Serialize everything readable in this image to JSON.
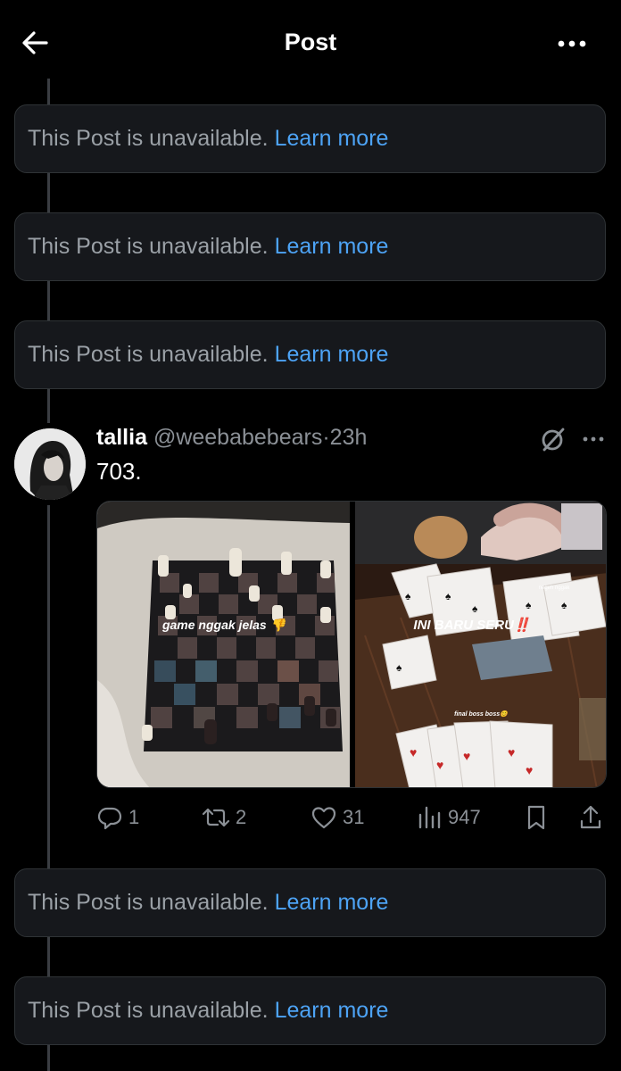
{
  "header": {
    "title": "Post"
  },
  "unavailable_notices": [
    {
      "text": "This Post is unavailable.",
      "link": "Learn more"
    },
    {
      "text": "This Post is unavailable.",
      "link": "Learn more"
    },
    {
      "text": "This Post is unavailable.",
      "link": "Learn more"
    },
    {
      "text": "This Post is unavailable.",
      "link": "Learn more"
    },
    {
      "text": "This Post is unavailable.",
      "link": "Learn more"
    }
  ],
  "post": {
    "display_name": "tallia",
    "handle": "@weebabebears",
    "separator": "·",
    "time": "23h",
    "text": "703.",
    "media": {
      "left_caption": "game nggak jelas 👎",
      "right_caption": "INI BARU SERU‼️",
      "right_small_caption_1": "negeh nggak",
      "right_small_caption_2": "final boss boss😊"
    },
    "metrics": {
      "replies": "1",
      "reposts": "2",
      "likes": "31",
      "views": "947"
    }
  },
  "icons": [
    "back-arrow-icon",
    "more-icon",
    "grok-icon",
    "reply-icon",
    "repost-icon",
    "like-icon",
    "views-icon",
    "bookmark-icon",
    "share-icon"
  ],
  "colors": {
    "background": "#000000",
    "card": "#16181c",
    "link": "#4da3f5",
    "muted": "#8b9096"
  }
}
